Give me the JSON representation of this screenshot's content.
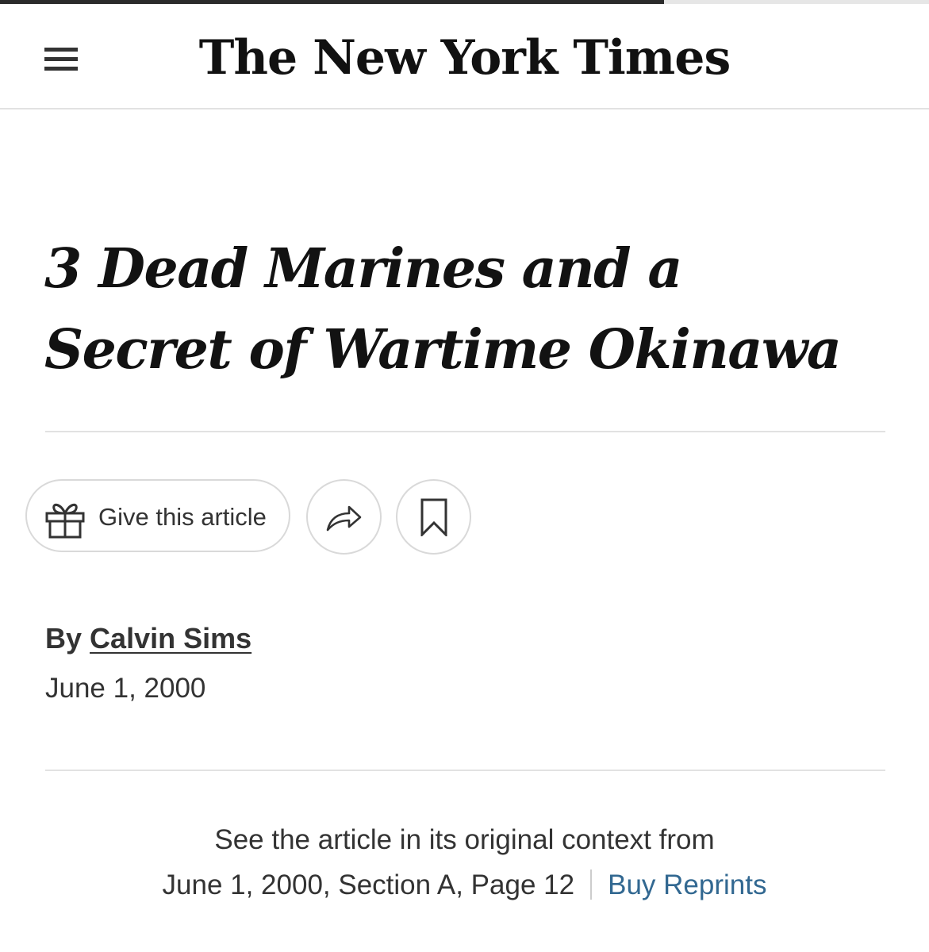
{
  "reading_progress": 0.715,
  "masthead": {
    "logo_text": "The New York Times"
  },
  "article": {
    "headline": "3 Dead Marines and a Secret of Wartime Okinawa",
    "byline_prefix": "By",
    "author": "Calvin Sims",
    "date": "June 1, 2000"
  },
  "actions": {
    "gift_label": "Give this article"
  },
  "context": {
    "line1": "See the article in its original context from",
    "print_info": "June 1, 2000, Section A, Page 12",
    "reprints_label": "Buy Reprints",
    "link_color": "#326891"
  },
  "icons": {
    "menu": "hamburger-menu-icon",
    "gift": "gift-icon",
    "share": "share-arrow-icon",
    "save": "bookmark-icon"
  }
}
